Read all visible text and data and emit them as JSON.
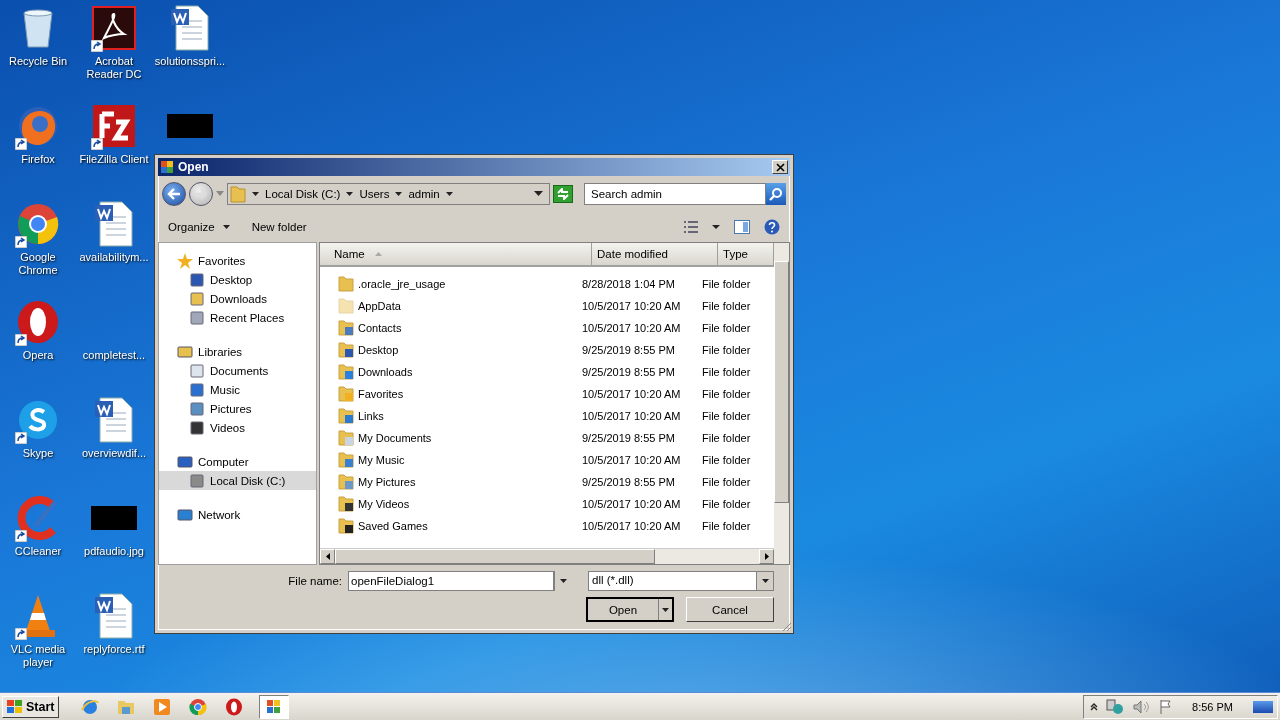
{
  "desktop_icons": [
    {
      "kind": "recycle",
      "label": "Recycle Bin",
      "shortcut": false
    },
    {
      "kind": "firefox",
      "label": "Firefox",
      "shortcut": true
    },
    {
      "kind": "chrome",
      "label": "Google Chrome",
      "shortcut": true
    },
    {
      "kind": "opera",
      "label": "Opera",
      "shortcut": true
    },
    {
      "kind": "skype",
      "label": "Skype",
      "shortcut": true
    },
    {
      "kind": "ccleaner",
      "label": "CCleaner",
      "shortcut": true
    },
    {
      "kind": "vlc",
      "label": "VLC media player",
      "shortcut": true
    },
    {
      "kind": "acrobat",
      "label": "Acrobat Reader DC",
      "shortcut": true
    },
    {
      "kind": "filezilla",
      "label": "FileZilla Client",
      "shortcut": true
    },
    {
      "kind": "word",
      "label": "availabilitym...",
      "shortcut": false
    },
    {
      "kind": "blank",
      "label": "completest...",
      "shortcut": false
    },
    {
      "kind": "word",
      "label": "overviewdif...",
      "shortcut": false
    },
    {
      "kind": "black",
      "label": "pdfaudio.jpg",
      "shortcut": false
    },
    {
      "kind": "word",
      "label": "replyforce.rtf",
      "shortcut": false
    },
    {
      "kind": "word",
      "label": "solutionsspri...",
      "shortcut": false
    },
    {
      "kind": "black",
      "shortcut": false
    }
  ],
  "dialog": {
    "title": "Open",
    "breadcrumb": [
      "Local Disk (C:)",
      "Users",
      "admin"
    ],
    "search": {
      "placeholder": "Search admin"
    },
    "toolbar": [
      {
        "label": "Organize",
        "dropdown": true
      },
      {
        "label": "New folder",
        "dropdown": false
      }
    ],
    "nav": [
      {
        "kind": "star",
        "label": "Favorites",
        "selected": false,
        "children": [
          {
            "kind": "desktop",
            "label": "Desktop",
            "selected": false
          },
          {
            "kind": "downloads",
            "label": "Downloads",
            "selected": false
          },
          {
            "kind": "recent",
            "label": "Recent Places",
            "selected": false
          }
        ]
      },
      {
        "kind": "library",
        "label": "Libraries",
        "selected": false,
        "children": [
          {
            "kind": "documents",
            "label": "Documents",
            "selected": false
          },
          {
            "kind": "music",
            "label": "Music",
            "selected": false
          },
          {
            "kind": "pictures",
            "label": "Pictures",
            "selected": false
          },
          {
            "kind": "videos",
            "label": "Videos",
            "selected": false
          }
        ]
      },
      {
        "kind": "computer",
        "label": "Computer",
        "selected": false,
        "children": [
          {
            "kind": "disk",
            "label": "Local Disk (C:)",
            "selected": true
          }
        ]
      },
      {
        "kind": "network",
        "label": "Network",
        "selected": false
      }
    ],
    "columns": [
      {
        "label": "Name",
        "sorted": true
      },
      {
        "label": "Date modified",
        "sorted": false
      },
      {
        "label": "Type",
        "sorted": false
      }
    ],
    "files": [
      {
        "name": ".oracle_jre_usage",
        "date": "8/28/2018 1:04 PM",
        "type": "File folder",
        "hidden": false,
        "kind": "plain"
      },
      {
        "name": "AppData",
        "date": "10/5/2017 10:20 AM",
        "type": "File folder",
        "hidden": true,
        "kind": "plain"
      },
      {
        "name": "Contacts",
        "date": "10/5/2017 10:20 AM",
        "type": "File folder",
        "hidden": false,
        "kind": "contacts"
      },
      {
        "name": "Desktop",
        "date": "9/25/2019 8:55 PM",
        "type": "File folder",
        "hidden": false,
        "kind": "desktop"
      },
      {
        "name": "Downloads",
        "date": "9/25/2019 8:55 PM",
        "type": "File folder",
        "hidden": false,
        "kind": "downloads"
      },
      {
        "name": "Favorites",
        "date": "10/5/2017 10:20 AM",
        "type": "File folder",
        "hidden": false,
        "kind": "star"
      },
      {
        "name": "Links",
        "date": "10/5/2017 10:20 AM",
        "type": "File folder",
        "hidden": false,
        "kind": "link"
      },
      {
        "name": "My Documents",
        "date": "9/25/2019 8:55 PM",
        "type": "File folder",
        "hidden": false,
        "kind": "documents"
      },
      {
        "name": "My Music",
        "date": "10/5/2017 10:20 AM",
        "type": "File folder",
        "hidden": false,
        "kind": "music"
      },
      {
        "name": "My Pictures",
        "date": "9/25/2019 8:55 PM",
        "type": "File folder",
        "hidden": false,
        "kind": "pictures"
      },
      {
        "name": "My Videos",
        "date": "10/5/2017 10:20 AM",
        "type": "File folder",
        "hidden": false,
        "kind": "videos"
      },
      {
        "name": "Saved Games",
        "date": "10/5/2017 10:20 AM",
        "type": "File folder",
        "hidden": false,
        "kind": "games"
      }
    ],
    "file_name_label": "File name:",
    "file_name": "openFileDialog1",
    "file_type": "dll (*.dll)",
    "buttons": [
      {
        "label": "Open",
        "kind": "split"
      },
      {
        "label": "Cancel",
        "kind": "plain"
      }
    ]
  },
  "taskbar": {
    "start": "Start",
    "apps": [
      {
        "kind": "ie",
        "selected": false
      },
      {
        "kind": "folder",
        "selected": false
      },
      {
        "kind": "media",
        "selected": false
      },
      {
        "kind": "chrome",
        "selected": false
      },
      {
        "kind": "opera",
        "selected": false
      },
      {
        "kind": "dialog",
        "selected": true
      }
    ],
    "clock": "8:56 PM"
  }
}
